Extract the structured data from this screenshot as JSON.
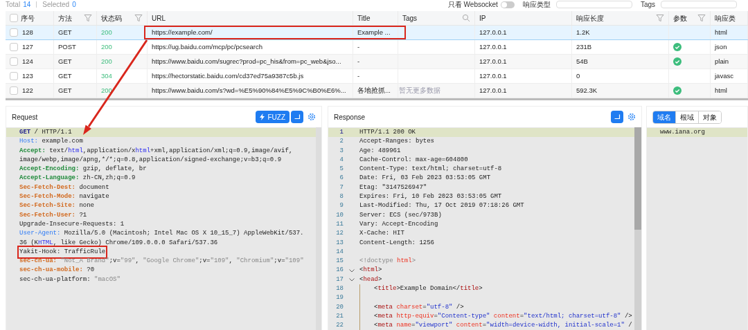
{
  "toolbar": {
    "total_label": "Total",
    "total": "14",
    "selected_label": "Selected",
    "selected": "0",
    "websocket_label": "只看 Websocket",
    "websocket_on": false,
    "type_label": "响应类型",
    "tags_label": "Tags"
  },
  "table": {
    "all_checked": false,
    "columns": [
      {
        "label": "序号",
        "filter": false,
        "search": false
      },
      {
        "label": "方法",
        "filter": true,
        "search": false
      },
      {
        "label": "状态码",
        "filter": true,
        "search": false
      },
      {
        "label": "URL",
        "filter": false,
        "search": false
      },
      {
        "label": "Title",
        "filter": false,
        "search": false
      },
      {
        "label": "Tags",
        "filter": false,
        "search": true
      },
      {
        "label": "IP",
        "filter": false,
        "search": false
      },
      {
        "label": "响应长度",
        "filter": true,
        "search": false
      },
      {
        "label": "参数",
        "filter": true,
        "search": false
      },
      {
        "label": "响应类",
        "filter": false,
        "search": false
      }
    ],
    "rows": [
      {
        "id": "128",
        "method": "GET",
        "status": "200",
        "url": "https://example.com/",
        "title": "Example ...",
        "ip": "127.0.0.1",
        "length": "1.2K",
        "params": false,
        "type": "html",
        "checked": false,
        "selected": true,
        "highlighted": true
      },
      {
        "id": "127",
        "method": "POST",
        "status": "200",
        "url": "https://ug.baidu.com/mcp/pc/pcsearch",
        "title": "-",
        "ip": "127.0.0.1",
        "length": "231B",
        "params": true,
        "type": "json",
        "checked": false,
        "selected": false,
        "highlighted": false
      },
      {
        "id": "124",
        "method": "GET",
        "status": "200",
        "url": "https://www.baidu.com/sugrec?prod=pc_his&from=pc_web&jso...",
        "title": "-",
        "ip": "127.0.0.1",
        "length": "54B",
        "params": true,
        "type": "plain",
        "checked": false,
        "selected": false,
        "highlighted": false
      },
      {
        "id": "123",
        "method": "GET",
        "status": "304",
        "url": "https://hectorstatic.baidu.com/cd37ed75a9387c5b.js",
        "title": "-",
        "ip": "127.0.0.1",
        "length": "0",
        "params": false,
        "type": "javasc",
        "checked": false,
        "selected": false,
        "highlighted": false
      },
      {
        "id": "122",
        "method": "GET",
        "status": "200",
        "url": "https://www.baidu.com/s?wd=%E5%90%84%E5%9C%B0%E6%...",
        "title": "各地抢抓...",
        "ip": "127.0.0.1",
        "length": "592.3K",
        "params": true,
        "type": "html",
        "checked": false,
        "selected": false,
        "highlighted": false
      }
    ],
    "empty_hint": "暂无更多数据"
  },
  "request": {
    "title": "Request",
    "fuzz_label": "FUZZ",
    "lines": [
      {
        "current": true,
        "highlighted": false,
        "tokens": [
          {
            "text": "GET",
            "kind": "method"
          },
          {
            "text": " / HTTP/1.1",
            "kind": "plain"
          }
        ]
      },
      {
        "current": false,
        "highlighted": false,
        "tokens": [
          {
            "text": "Host:",
            "kind": "key-blue"
          },
          {
            "text": " example.com",
            "kind": "plain"
          }
        ]
      },
      {
        "current": false,
        "highlighted": false,
        "tokens": [
          {
            "text": "Accept:",
            "kind": "key-green"
          },
          {
            "text": " text/",
            "kind": "plain"
          },
          {
            "text": "html",
            "kind": "kw"
          },
          {
            "text": ",application/x",
            "kind": "plain"
          },
          {
            "text": "html",
            "kind": "kw"
          },
          {
            "text": "+xml,application/xml;q=0.9,image/avif,",
            "kind": "plain"
          }
        ]
      },
      {
        "current": false,
        "highlighted": false,
        "tokens": [
          {
            "text": "image/webp,image/apng,*/*;q=0.8,application/signed-exchange;v=b3;q=0.9",
            "kind": "plain"
          }
        ]
      },
      {
        "current": false,
        "highlighted": false,
        "tokens": [
          {
            "text": "Accept-Encoding:",
            "kind": "key-green"
          },
          {
            "text": " gzip, deflate, br",
            "kind": "plain"
          }
        ]
      },
      {
        "current": false,
        "highlighted": false,
        "tokens": [
          {
            "text": "Accept-Language:",
            "kind": "key-green"
          },
          {
            "text": " zh-CN,zh;q=0.9",
            "kind": "plain"
          }
        ]
      },
      {
        "current": false,
        "highlighted": false,
        "tokens": [
          {
            "text": "Sec-Fetch-Dest:",
            "kind": "key-orange"
          },
          {
            "text": " document",
            "kind": "plain"
          }
        ]
      },
      {
        "current": false,
        "highlighted": false,
        "tokens": [
          {
            "text": "Sec-Fetch-Mode:",
            "kind": "key-orange"
          },
          {
            "text": " navigate",
            "kind": "plain"
          }
        ]
      },
      {
        "current": false,
        "highlighted": false,
        "tokens": [
          {
            "text": "Sec-Fetch-Site:",
            "kind": "key-orange"
          },
          {
            "text": " none",
            "kind": "plain"
          }
        ]
      },
      {
        "current": false,
        "highlighted": false,
        "tokens": [
          {
            "text": "Sec-Fetch-User:",
            "kind": "key-orange"
          },
          {
            "text": " ?1",
            "kind": "plain"
          }
        ]
      },
      {
        "current": false,
        "highlighted": false,
        "tokens": [
          {
            "text": "Upgrade-Insecure-Requests: 1",
            "kind": "plain"
          }
        ]
      },
      {
        "current": false,
        "highlighted": false,
        "tokens": [
          {
            "text": "User-Agent:",
            "kind": "key-blue"
          },
          {
            "text": " Mozilla/5.0 (Macintosh; Intel Mac OS X 10_15_7) AppleWebKit/537.",
            "kind": "plain"
          }
        ]
      },
      {
        "current": false,
        "highlighted": false,
        "tokens": [
          {
            "text": "36 (K",
            "kind": "plain"
          },
          {
            "text": "HTML",
            "kind": "kw"
          },
          {
            "text": ", like Gecko) Chrome/109.0.0.0 Safari/537.36",
            "kind": "plain"
          }
        ]
      },
      {
        "current": false,
        "highlighted": true,
        "tokens": [
          {
            "text": "Yakit-Hook: TrafficRule",
            "kind": "plain"
          }
        ]
      },
      {
        "current": false,
        "highlighted": false,
        "tokens": [
          {
            "text": "sec-ch-ua: ",
            "kind": "key-orange"
          },
          {
            "text": "\"Not_A Brand\"",
            "kind": "str"
          },
          {
            "text": ";v=",
            "kind": "plain"
          },
          {
            "text": "\"99\"",
            "kind": "str"
          },
          {
            "text": ", ",
            "kind": "plain"
          },
          {
            "text": "\"Google Chrome\"",
            "kind": "str"
          },
          {
            "text": ";v=",
            "kind": "plain"
          },
          {
            "text": "\"109\"",
            "kind": "str"
          },
          {
            "text": ", ",
            "kind": "plain"
          },
          {
            "text": "\"Chromium\"",
            "kind": "str"
          },
          {
            "text": ";v=",
            "kind": "plain"
          },
          {
            "text": "\"109\"",
            "kind": "str"
          }
        ]
      },
      {
        "current": false,
        "highlighted": false,
        "tokens": [
          {
            "text": "sec-ch-ua-mobile:",
            "kind": "key-orange"
          },
          {
            "text": " ?0",
            "kind": "plain"
          }
        ]
      },
      {
        "current": false,
        "highlighted": false,
        "tokens": [
          {
            "text": "sec-ch-ua-platform: ",
            "kind": "plain"
          },
          {
            "text": "\"macOS\"",
            "kind": "str"
          }
        ]
      }
    ]
  },
  "response": {
    "title": "Response",
    "lines": [
      {
        "n": "1",
        "current": true,
        "fold": false,
        "guide": false,
        "tokens": [
          {
            "text": "HTTP/1.1 200 OK",
            "kind": "plain"
          }
        ]
      },
      {
        "n": "2",
        "current": false,
        "fold": false,
        "guide": false,
        "tokens": [
          {
            "text": "Accept-Ranges: bytes",
            "kind": "plain"
          }
        ]
      },
      {
        "n": "3",
        "current": false,
        "fold": false,
        "guide": false,
        "tokens": [
          {
            "text": "Age: 489961",
            "kind": "plain"
          }
        ]
      },
      {
        "n": "4",
        "current": false,
        "fold": false,
        "guide": false,
        "tokens": [
          {
            "text": "Cache-Control: max-age=604800",
            "kind": "plain"
          }
        ]
      },
      {
        "n": "5",
        "current": false,
        "fold": false,
        "guide": false,
        "tokens": [
          {
            "text": "Content-Type: text/html; charset=utf-8",
            "kind": "plain"
          }
        ]
      },
      {
        "n": "6",
        "current": false,
        "fold": false,
        "guide": false,
        "tokens": [
          {
            "text": "Date: Fri, 03 Feb 2023 03:53:05 GMT",
            "kind": "plain"
          }
        ]
      },
      {
        "n": "7",
        "current": false,
        "fold": false,
        "guide": false,
        "tokens": [
          {
            "text": "Etag: \"3147526947\"",
            "kind": "plain"
          }
        ]
      },
      {
        "n": "8",
        "current": false,
        "fold": false,
        "guide": false,
        "tokens": [
          {
            "text": "Expires: Fri, 10 Feb 2023 03:53:05 GMT",
            "kind": "plain"
          }
        ]
      },
      {
        "n": "9",
        "current": false,
        "fold": false,
        "guide": false,
        "tokens": [
          {
            "text": "Last-Modified: Thu, 17 Oct 2019 07:18:26 GMT",
            "kind": "plain"
          }
        ]
      },
      {
        "n": "10",
        "current": false,
        "fold": false,
        "guide": false,
        "tokens": [
          {
            "text": "Server: ECS (sec/973B)",
            "kind": "plain"
          }
        ]
      },
      {
        "n": "11",
        "current": false,
        "fold": false,
        "guide": false,
        "tokens": [
          {
            "text": "Vary: Accept-Encoding",
            "kind": "plain"
          }
        ]
      },
      {
        "n": "12",
        "current": false,
        "fold": false,
        "guide": false,
        "tokens": [
          {
            "text": "X-Cache: HIT",
            "kind": "plain"
          }
        ]
      },
      {
        "n": "13",
        "current": false,
        "fold": false,
        "guide": false,
        "tokens": [
          {
            "text": "Content-Length: 1256",
            "kind": "plain"
          }
        ]
      },
      {
        "n": "14",
        "current": false,
        "fold": false,
        "guide": false
      },
      {
        "n": "15",
        "current": false,
        "fold": false,
        "guide": false,
        "tokens": [
          {
            "text": "<!doctype ",
            "kind": "doctype"
          },
          {
            "text": "html",
            "kind": "attr"
          },
          {
            "text": ">",
            "kind": "doctype"
          }
        ]
      },
      {
        "n": "16",
        "current": false,
        "fold": true,
        "guide": false,
        "tokens": [
          {
            "text": "<",
            "kind": "plain"
          },
          {
            "text": "html",
            "kind": "tag"
          },
          {
            "text": ">",
            "kind": "plain"
          }
        ]
      },
      {
        "n": "17",
        "current": false,
        "fold": true,
        "guide": false,
        "tokens": [
          {
            "text": "<",
            "kind": "plain"
          },
          {
            "text": "head",
            "kind": "tag"
          },
          {
            "text": ">",
            "kind": "plain"
          }
        ]
      },
      {
        "n": "18",
        "current": false,
        "fold": false,
        "guide": true,
        "tokens": [
          {
            "text": "<",
            "kind": "plain"
          },
          {
            "text": "title",
            "kind": "tag"
          },
          {
            "text": ">Example Domain</",
            "kind": "plain"
          },
          {
            "text": "title",
            "kind": "tag"
          },
          {
            "text": ">",
            "kind": "plain"
          }
        ]
      },
      {
        "n": "19",
        "current": false,
        "fold": false,
        "guide": true
      },
      {
        "n": "20",
        "current": false,
        "fold": false,
        "guide": true,
        "tokens": [
          {
            "text": "<",
            "kind": "plain"
          },
          {
            "text": "meta",
            "kind": "tag"
          },
          {
            "text": " charset",
            "kind": "attr"
          },
          {
            "text": "=",
            "kind": "plain"
          },
          {
            "text": "\"utf-8\"",
            "kind": "val"
          },
          {
            "text": " />",
            "kind": "plain"
          }
        ]
      },
      {
        "n": "21",
        "current": false,
        "fold": false,
        "guide": true,
        "tokens": [
          {
            "text": "<",
            "kind": "plain"
          },
          {
            "text": "meta",
            "kind": "tag"
          },
          {
            "text": " http-equiv",
            "kind": "attr"
          },
          {
            "text": "=",
            "kind": "plain"
          },
          {
            "text": "\"Content-type\"",
            "kind": "val"
          },
          {
            "text": " content",
            "kind": "attr"
          },
          {
            "text": "=",
            "kind": "plain"
          },
          {
            "text": "\"text/html; charset=utf-8\"",
            "kind": "val"
          },
          {
            "text": " />",
            "kind": "plain"
          }
        ]
      },
      {
        "n": "22",
        "current": false,
        "fold": false,
        "guide": true,
        "tokens": [
          {
            "text": "<",
            "kind": "plain"
          },
          {
            "text": "meta",
            "kind": "tag"
          },
          {
            "text": " name",
            "kind": "attr"
          },
          {
            "text": "=",
            "kind": "plain"
          },
          {
            "text": "\"viewport\"",
            "kind": "val"
          },
          {
            "text": " content",
            "kind": "attr"
          },
          {
            "text": "=",
            "kind": "plain"
          },
          {
            "text": "\"width=device-width, initial-scale=1\"",
            "kind": "val"
          },
          {
            "text": " /",
            "kind": "plain"
          }
        ]
      }
    ]
  },
  "side": {
    "tabs": [
      {
        "label": "域名",
        "selected": true
      },
      {
        "label": "根域",
        "selected": false
      },
      {
        "label": "对象",
        "selected": false
      }
    ],
    "items": [
      {
        "text": "www.iana.org",
        "current": true
      }
    ]
  }
}
